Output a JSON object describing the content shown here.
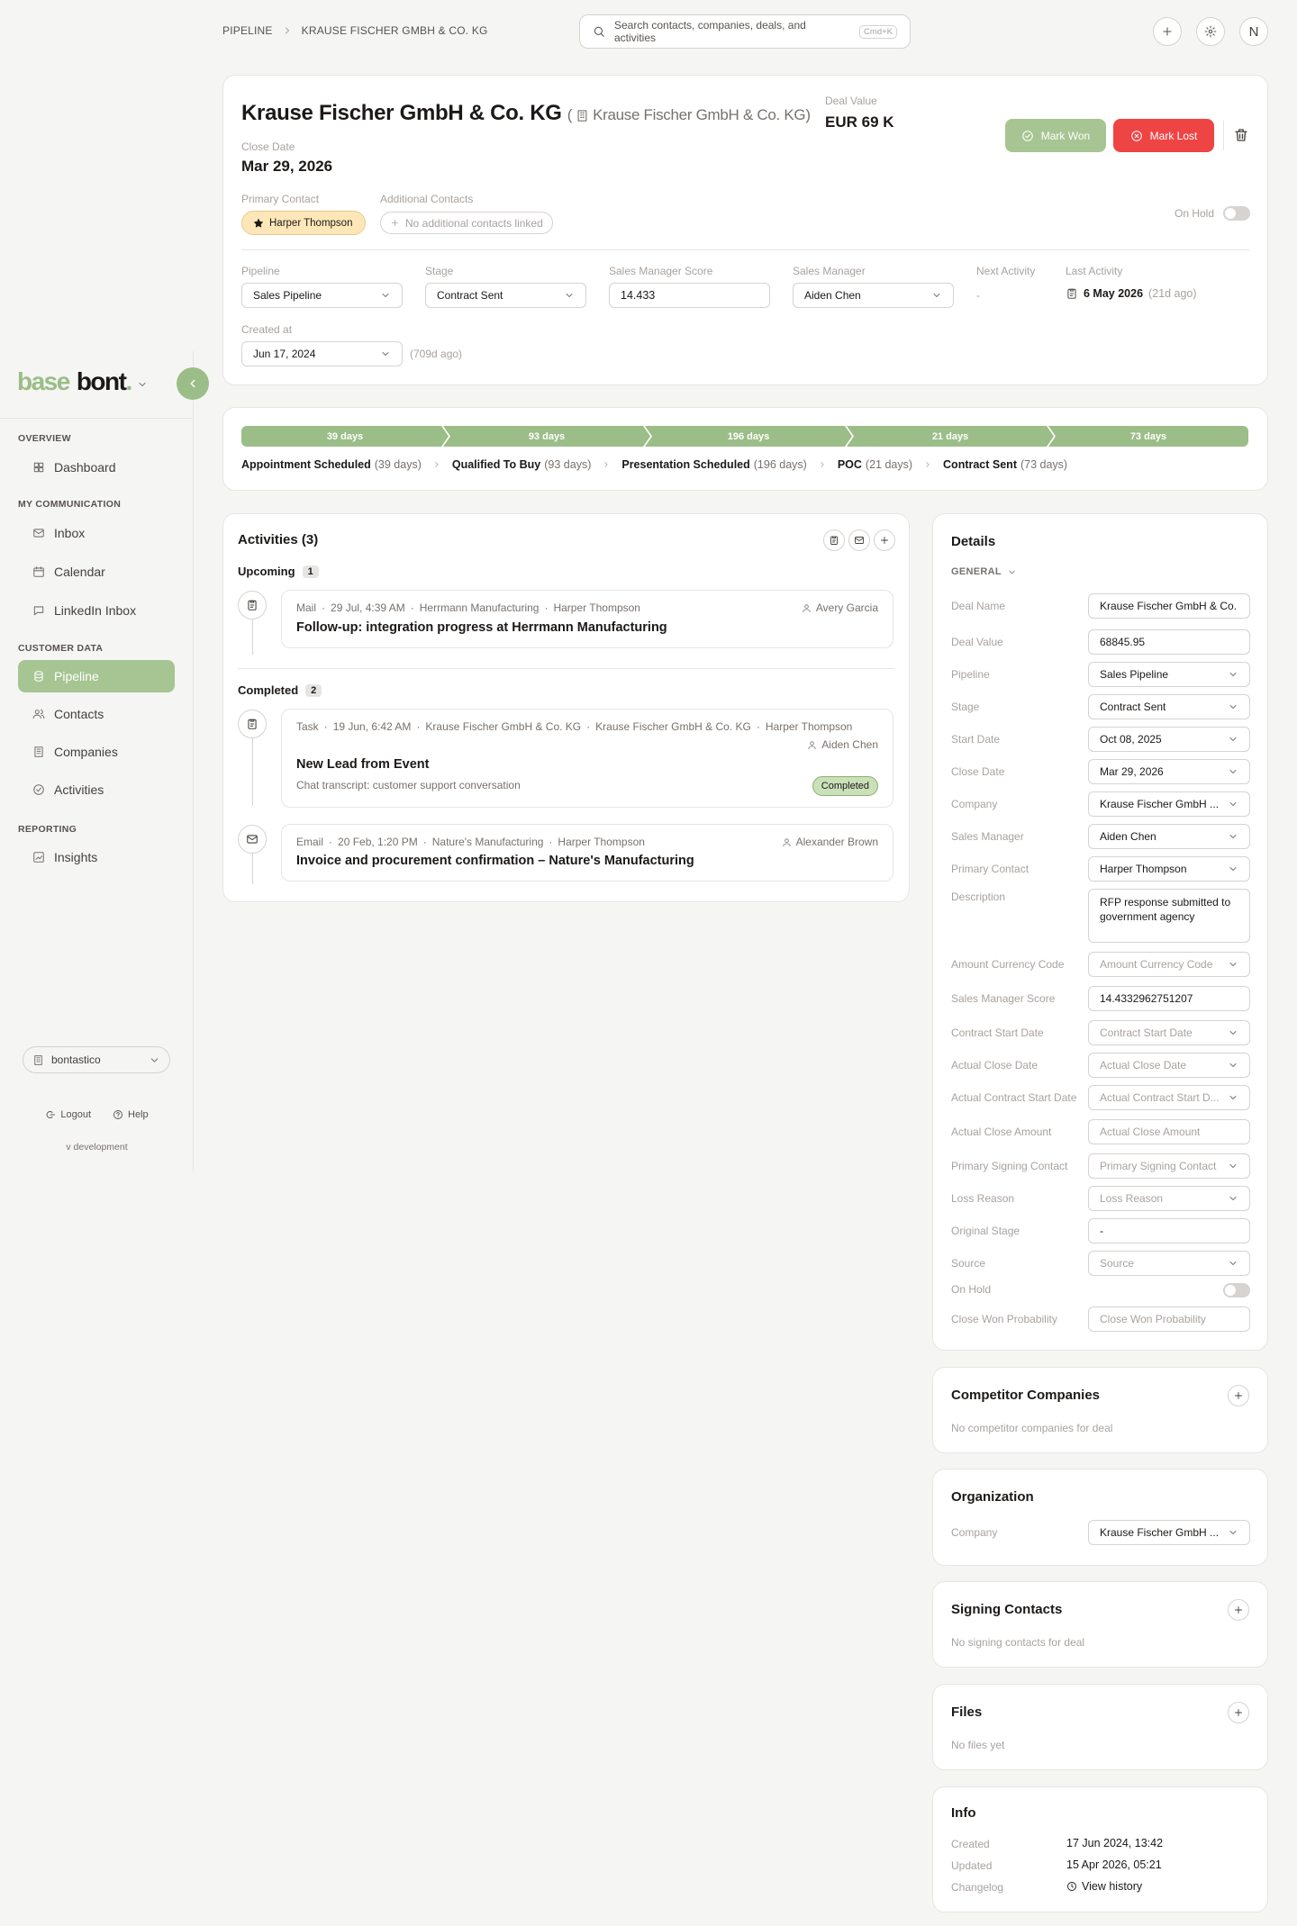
{
  "breadcrumb": {
    "root": "PIPELINE",
    "current": "KRAUSE FISCHER GMBH & CO. KG"
  },
  "search": {
    "placeholder": "Search contacts, companies, deals, and activities",
    "shortcut": "Cmd+K"
  },
  "user": {
    "initial": "N"
  },
  "sidebar": {
    "logo_a": "base",
    "logo_b": "bont",
    "logo_dot": ".",
    "sections": {
      "overview": "OVERVIEW",
      "communication": "MY COMMUNICATION",
      "customer": "CUSTOMER DATA",
      "reporting": "REPORTING"
    },
    "items": {
      "dashboard": "Dashboard",
      "inbox": "Inbox",
      "calendar": "Calendar",
      "linkedin": "LinkedIn Inbox",
      "pipeline": "Pipeline",
      "contacts": "Contacts",
      "companies": "Companies",
      "activities": "Activities",
      "insights": "Insights"
    },
    "workspace": "bontastico",
    "logout": "Logout",
    "help": "Help",
    "version": "v development"
  },
  "deal": {
    "title": "Krause Fischer GmbH & Co. KG",
    "company_open": "(",
    "company": "Krause Fischer GmbH & Co. KG)",
    "deal_value_label": "Deal Value",
    "deal_value": "EUR 69 K",
    "close_date_label": "Close Date",
    "close_date": "Mar 29, 2026",
    "mark_won": "Mark Won",
    "mark_lost": "Mark Lost",
    "primary_contact_label": "Primary Contact",
    "primary_contact": "Harper Thompson",
    "additional_contacts_label": "Additional Contacts",
    "additional_contacts_empty": "No additional contacts linked",
    "on_hold_label": "On Hold",
    "pipeline_label": "Pipeline",
    "pipeline": "Sales Pipeline",
    "stage_label": "Stage",
    "stage": "Contract Sent",
    "score_label": "Sales Manager Score",
    "score": "14.433",
    "manager_label": "Sales Manager",
    "manager": "Aiden Chen",
    "next_activity_label": "Next Activity",
    "next_activity": "-",
    "last_activity_label": "Last Activity",
    "last_activity": "6 May 2026",
    "last_activity_ago": "(21d ago)",
    "created_label": "Created at",
    "created": "Jun 17, 2024",
    "created_ago": "(709d ago)"
  },
  "stages": [
    {
      "name": "Appointment Scheduled",
      "days_bar": "39 days",
      "days": "(39 days)"
    },
    {
      "name": "Qualified To Buy",
      "days_bar": "93 days",
      "days": "(93 days)"
    },
    {
      "name": "Presentation Scheduled",
      "days_bar": "196 days",
      "days": "(196 days)"
    },
    {
      "name": "POC",
      "days_bar": "21 days",
      "days": "(21 days)"
    },
    {
      "name": "Contract Sent",
      "days_bar": "73 days",
      "days": "(73 days)"
    }
  ],
  "activities": {
    "title": "Activities (3)",
    "upcoming_label": "Upcoming",
    "upcoming_count": "1",
    "completed_label": "Completed",
    "completed_count": "2",
    "items": [
      {
        "type": "Mail",
        "time": "29 Jul, 4:39 AM",
        "ref1": "Herrmann Manufacturing",
        "ref2": "Harper Thompson",
        "user": "Avery Garcia",
        "title": "Follow-up: integration progress at Herrmann Manufacturing"
      },
      {
        "type": "Task",
        "time": "19 Jun, 6:42 AM",
        "ref1": "Krause Fischer GmbH & Co. KG",
        "ref2": "Krause Fischer GmbH & Co. KG",
        "ref3": "Harper Thompson",
        "user": "Aiden Chen",
        "title": "New Lead from Event",
        "desc": "Chat transcript: customer support conversation",
        "status": "Completed"
      },
      {
        "type": "Email",
        "time": "20 Feb, 1:20 PM",
        "ref1": "Nature's Manufacturing",
        "ref2": "Harper Thompson",
        "user": "Alexander Brown",
        "title": "Invoice and procurement confirmation – Nature's Manufacturing"
      }
    ]
  },
  "details": {
    "title": "Details",
    "general": "GENERAL",
    "rows": [
      {
        "label": "Deal Name",
        "value": "Krause Fischer GmbH & Co."
      },
      {
        "label": "Deal Value",
        "value": "68845.95"
      },
      {
        "label": "Pipeline",
        "value": "Sales Pipeline"
      },
      {
        "label": "Stage",
        "value": "Contract Sent"
      },
      {
        "label": "Start Date",
        "value": "Oct 08, 2025"
      },
      {
        "label": "Close Date",
        "value": "Mar 29, 2026"
      },
      {
        "label": "Company",
        "value": "Krause Fischer GmbH ..."
      },
      {
        "label": "Sales Manager",
        "value": "Aiden Chen"
      },
      {
        "label": "Primary Contact",
        "value": "Harper Thompson"
      },
      {
        "label": "Description",
        "value": "RFP response submitted to government agency"
      },
      {
        "label": "Amount Currency Code",
        "value": "Amount Currency Code"
      },
      {
        "label": "Sales Manager Score",
        "value": "14.4332962751207"
      },
      {
        "label": "Contract Start Date",
        "value": "Contract Start Date"
      },
      {
        "label": "Actual Close Date",
        "value": "Actual Close Date"
      },
      {
        "label": "Actual Contract Start Date",
        "value": "Actual Contract Start D..."
      },
      {
        "label": "Actual Close Amount",
        "value": "Actual Close Amount"
      },
      {
        "label": "Primary Signing Contact",
        "value": "Primary Signing Contact"
      },
      {
        "label": "Loss Reason",
        "value": "Loss Reason"
      },
      {
        "label": "Original Stage",
        "value": "-"
      },
      {
        "label": "Source",
        "value": "Source"
      },
      {
        "label": "On Hold",
        "value": ""
      },
      {
        "label": "Close Won Probability",
        "value": "Close Won Probability"
      }
    ]
  },
  "competitors": {
    "title": "Competitor Companies",
    "empty": "No competitor companies for deal"
  },
  "organization": {
    "title": "Organization",
    "company_label": "Company",
    "company": "Krause Fischer GmbH ..."
  },
  "signing": {
    "title": "Signing Contacts",
    "empty": "No signing contacts for deal"
  },
  "files": {
    "title": "Files",
    "empty": "No files yet"
  },
  "info": {
    "title": "Info",
    "created_label": "Created",
    "created": "17 Jun 2024, 13:42",
    "updated_label": "Updated",
    "updated": "15 Apr 2026, 05:21",
    "changelog_label": "Changelog",
    "changelog": "View history"
  }
}
